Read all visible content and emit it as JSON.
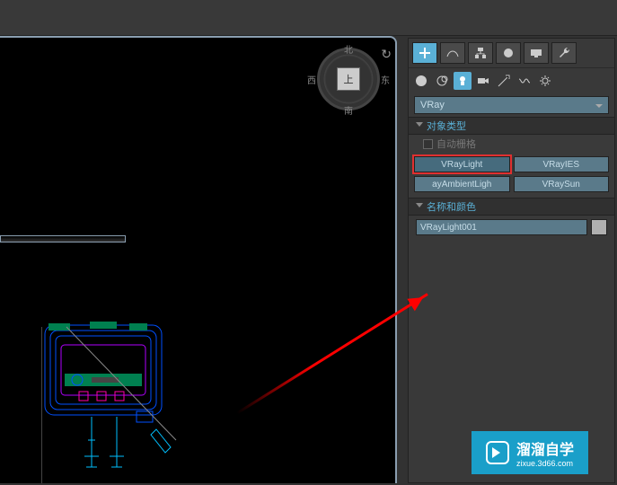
{
  "sidebar": {
    "renderer_dropdown": "VRay",
    "sections": {
      "object_type": {
        "title": "对象类型",
        "auto_grid_label": "自动栅格",
        "buttons": [
          {
            "label": "VRayLight"
          },
          {
            "label": "VRayIES"
          },
          {
            "label": "ayAmbientLigh"
          },
          {
            "label": "VRaySun"
          }
        ]
      },
      "name_color": {
        "title": "名称和颜色",
        "name_value": "VRayLight001"
      }
    }
  },
  "viewport": {
    "viewcube_face": "上",
    "compass": {
      "n": "北",
      "s": "南",
      "e": "东",
      "w": "西"
    }
  },
  "watermark": {
    "title": "溜溜自学",
    "subtitle": "zixue.3d66.com"
  }
}
